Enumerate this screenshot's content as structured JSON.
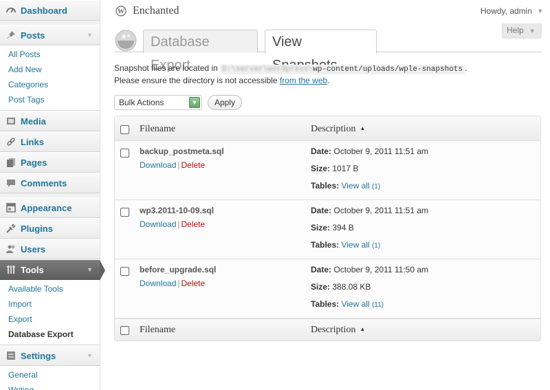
{
  "sidebar": {
    "dashboard": "Dashboard",
    "posts": "Posts",
    "posts_sub": [
      "All Posts",
      "Add New",
      "Categories",
      "Post Tags"
    ],
    "media": "Media",
    "links": "Links",
    "pages": "Pages",
    "comments": "Comments",
    "appearance": "Appearance",
    "plugins": "Plugins",
    "users": "Users",
    "tools": "Tools",
    "tools_sub": [
      "Available Tools",
      "Import",
      "Export",
      "Database Export"
    ],
    "settings": "Settings",
    "settings_sub": [
      "General",
      "Writing"
    ]
  },
  "header": {
    "site_title": "Enchanted",
    "howdy": "Howdy, admin",
    "help": "Help"
  },
  "tabs": {
    "export": "Database Export",
    "snapshots": "View Snapshots"
  },
  "intro": {
    "line1_prefix": "Snapshot files are located in",
    "path_hidden": "D:\\server\\wordpress\\",
    "path_visible": "wp-content/uploads/wple-snapshots",
    "line1_suffix": ".",
    "line2_prefix": "Please ensure the directory is not accessible",
    "line2_link": "from the web",
    "line2_suffix": "."
  },
  "bulk": {
    "selected": "Bulk Actions",
    "apply": "Apply"
  },
  "table": {
    "col_filename": "Filename",
    "col_description": "Description",
    "download": "Download",
    "delete": "Delete",
    "date_label": "Date:",
    "size_label": "Size:",
    "tables_label": "Tables:",
    "view_all": "View all",
    "rows": [
      {
        "filename": "backup_postmeta.sql",
        "date": "October 9, 2011 11:51 am",
        "size": "1017 B",
        "count": "(1)"
      },
      {
        "filename": "wp3.2011-10-09.sql",
        "date": "October 9, 2011 11:51 am",
        "size": "394 B",
        "count": "(1)"
      },
      {
        "filename": "before_upgrade.sql",
        "date": "October 9, 2011 11:50 am",
        "size": "388.08 KB",
        "count": "(11)"
      }
    ]
  }
}
